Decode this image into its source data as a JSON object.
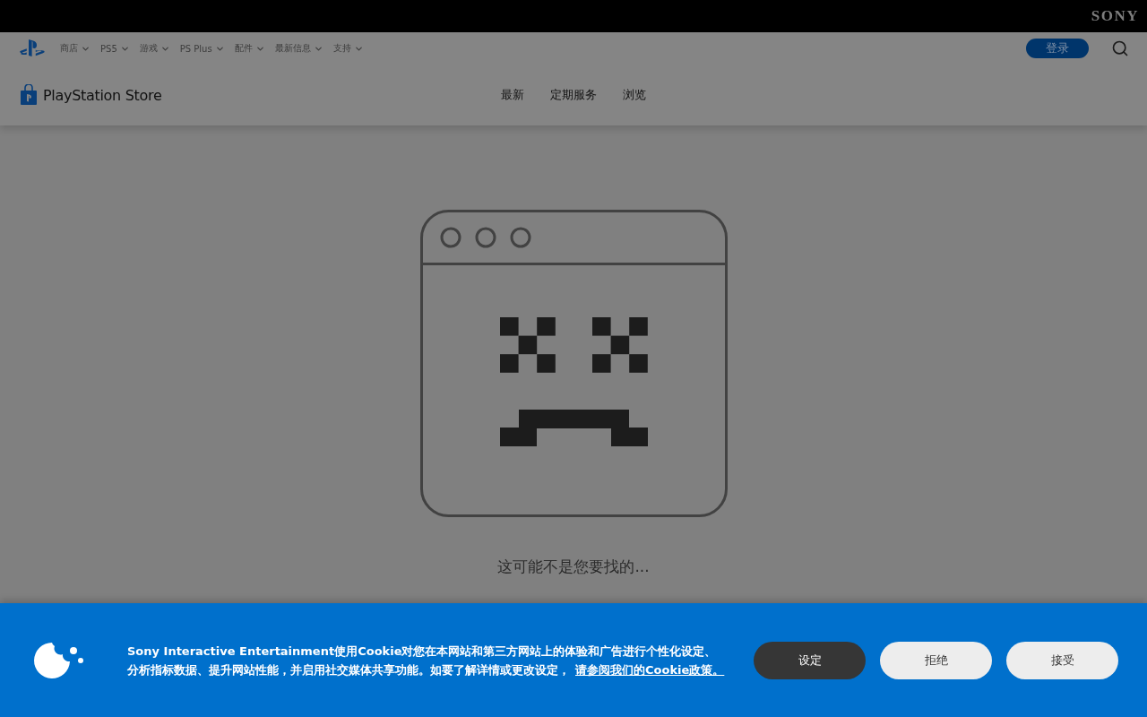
{
  "brand": "SONY",
  "nav": {
    "items": [
      {
        "label": "商店"
      },
      {
        "label": "PS5"
      },
      {
        "label": "游戏"
      },
      {
        "label": "PS Plus"
      },
      {
        "label": "配件"
      },
      {
        "label": "最新信息"
      },
      {
        "label": "支持"
      }
    ],
    "login": "登录"
  },
  "store": {
    "logo": "PlayStation Store",
    "links": [
      "最新",
      "定期服务",
      "浏览"
    ]
  },
  "error": {
    "title": "这可能不是您要找的..."
  },
  "cookie": {
    "text": "Sony Interactive Entertainment使用Cookie对您在本网站和第三方网站上的体验和广告进行个性化设定、分析指标数据、提升网站性能，并启用社交媒体共享功能。如要了解详情或更改设定，",
    "link": "请参阅我们的Cookie政策。",
    "buttons": [
      {
        "label": "设定",
        "kind": "dark"
      },
      {
        "label": "拒绝",
        "kind": "light"
      },
      {
        "label": "接受",
        "kind": "light"
      }
    ]
  }
}
